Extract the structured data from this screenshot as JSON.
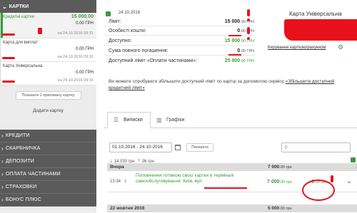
{
  "sidebar": {
    "header": "КАРТКИ",
    "cards": [
      {
        "name": "Кредитні картки",
        "amount": "15 000.00",
        "balance": "0.00 ГРН",
        "date": "на 24.10.2016 09:31"
      },
      {
        "name": "Карта для виплат",
        "amount": "",
        "balance": "0.00 ГРН",
        "date": "на 24.10.2016 09:31"
      },
      {
        "name": "Карта Універсальна",
        "amount": "",
        "balance": "0.00 ГРН",
        "date": "на 24.10.2016 09:31"
      }
    ],
    "show_hidden": "Показати 1 прихованy картку",
    "add_card": "Додати картку",
    "menu": [
      "КРЕДИТИ",
      "СКАРБНИЧКА",
      "ДЕПОЗИТИ",
      "ОПЛАТА ЧАСТИНАМИ",
      "СТРАХОВКИ",
      "БОНУС ПЛЮС"
    ]
  },
  "card": {
    "date": "24.10.2016",
    "title": "Карта Універсальна",
    "manage_link": "Керування карткою/рахунком",
    "rows": [
      {
        "label": "Ліміт:",
        "value": "15 000",
        "unit": ".00 ГРН",
        "green": false
      },
      {
        "label": "Особисті кошти:",
        "value": "0",
        "unit": ".00 ГРН",
        "green": false
      },
      {
        "label": "Доступно:",
        "value": "15 000",
        "unit": ".00 ГРН",
        "green": true
      },
      {
        "label": "Сума повного погашення:",
        "value": "0",
        "unit": ".00 ГРН",
        "green": false
      },
      {
        "label": "Доступний ліміт «Оплати частинами»:",
        "value": "25 000",
        "unit": ".00 ГРН",
        "green": true
      }
    ],
    "promo_text": "Ви можете спробувати збільшити доступний ліміт по картці за допомогою сервісу ",
    "promo_link": "«Збільшити доступний кредитний ліміт»"
  },
  "tabs": {
    "statements": "Виписки",
    "charts": "Графіки"
  },
  "filter": {
    "date_range": "01.10.2016 - 24.10.2016",
    "show_button": "Показати",
    "search_placeholder": ""
  },
  "totals": {
    "income": "14 030 грн",
    "outcome": "36 грн"
  },
  "groups": [
    {
      "date": "Вчора",
      "total": "7 000",
      "unit": ".00 грн",
      "fee": ""
    },
    {
      "date": "22 жовтня 2016",
      "total": "5 000",
      "unit": ".00 грн",
      "fee": ""
    }
  ],
  "transaction": {
    "time": "13:34",
    "description": "Поповнення готівкою своєї картки в терміналі самообслуговування: Київ, вул.",
    "amount": "7 000",
    "amount_unit": ".00 грн",
    "fee": "- 8",
    "fee_unit": ".00 грн"
  },
  "colors": {
    "accent": "#3a9a3a",
    "sidebar_dark": "#5a5a5a",
    "annotation": "#e8101b"
  }
}
